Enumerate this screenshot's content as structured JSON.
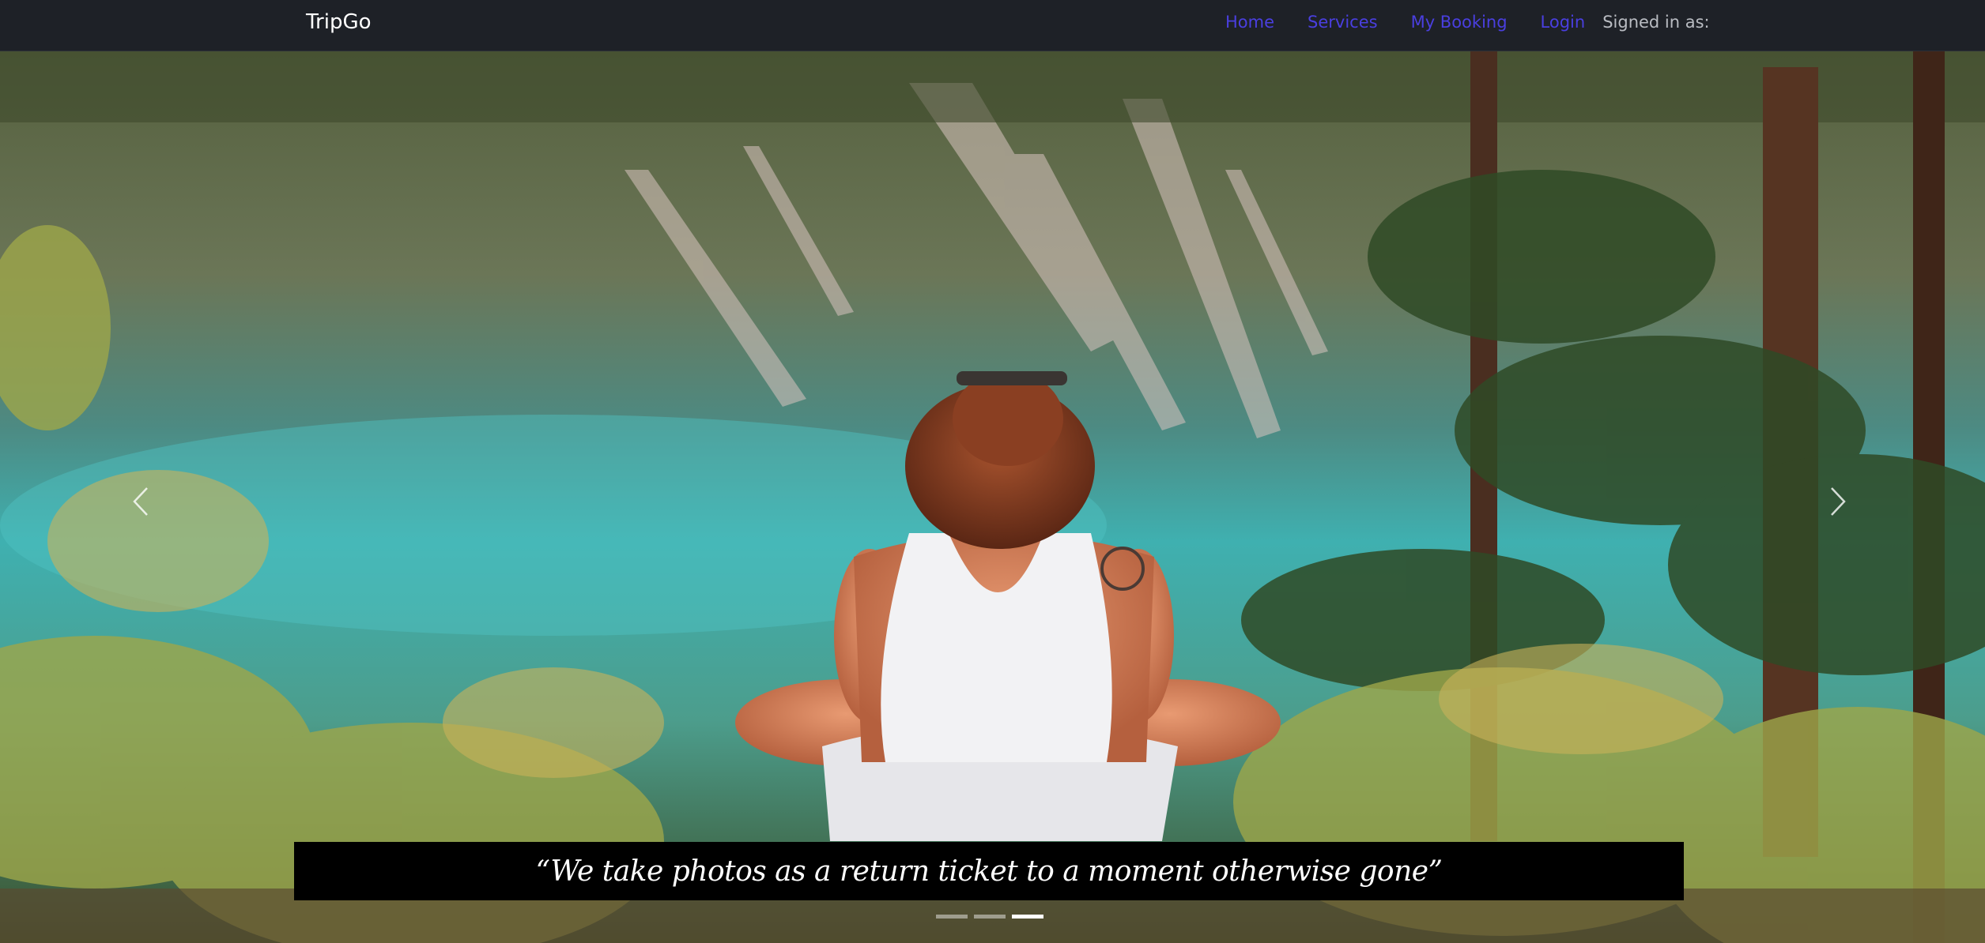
{
  "navbar": {
    "brand": "TripGo",
    "links": [
      {
        "label": "Home"
      },
      {
        "label": "Services"
      },
      {
        "label": "My Booking"
      },
      {
        "label": "Login"
      }
    ],
    "signed_in_label": "Signed in as:",
    "link_color": "#4a3fe0",
    "background": "#1e2127"
  },
  "carousel": {
    "caption": "“We take photos as a return ticket to a moment otherwise gone”",
    "slide_count": 3,
    "active_slide": 3,
    "prev_icon": "chevron-left-icon",
    "next_icon": "chevron-right-icon"
  }
}
